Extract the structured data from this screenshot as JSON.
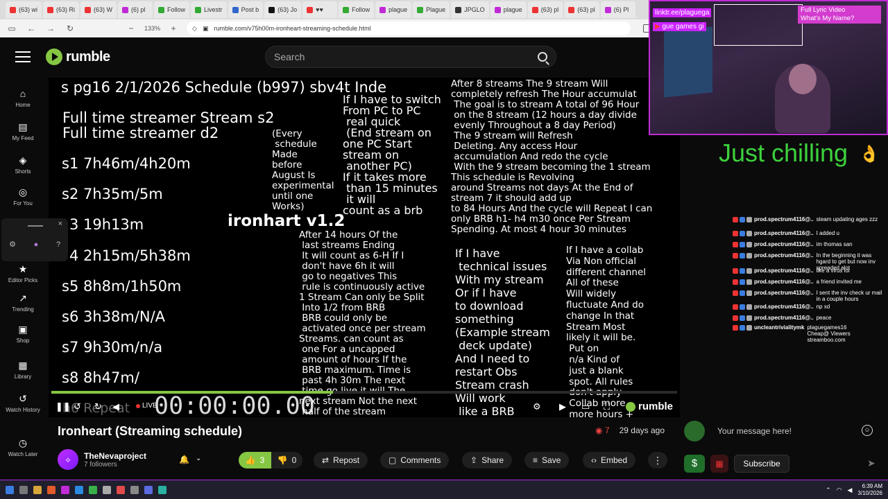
{
  "browser": {
    "tabs": [
      {
        "label": "(63) wi",
        "color": "#e33"
      },
      {
        "label": "(63) Ri",
        "color": "#e33"
      },
      {
        "label": "(63) W",
        "color": "#e33"
      },
      {
        "label": "(6) pl",
        "color": "#c02bd6"
      },
      {
        "label": "Follow",
        "color": "#3a3"
      },
      {
        "label": "Livestr",
        "color": "#3a3"
      },
      {
        "label": "Post b",
        "color": "#36c"
      },
      {
        "label": "(63) Jo",
        "color": "#111"
      },
      {
        "label": "♥♥",
        "color": "#e33"
      },
      {
        "label": "Follow",
        "color": "#3a3"
      },
      {
        "label": "plague",
        "color": "#c02bd6"
      },
      {
        "label": "Plague",
        "color": "#3a3"
      },
      {
        "label": "JPGLO",
        "color": "#333"
      },
      {
        "label": "plague",
        "color": "#c02bd6"
      },
      {
        "label": "(63) pl",
        "color": "#e33"
      },
      {
        "label": "(63) pl",
        "color": "#e33"
      },
      {
        "label": "(6) Pl",
        "color": "#c02bd6"
      }
    ],
    "zoom": "133%",
    "url": "rumble.com/v75h00m-ironheart-streaming-schedule.html"
  },
  "header": {
    "logo_text": "rumble",
    "search_placeholder": "Search"
  },
  "leftnav": [
    {
      "label": "Home",
      "icon": "home-icon",
      "glyph": "⌂"
    },
    {
      "label": "My Feed",
      "icon": "feed-icon",
      "glyph": "▤"
    },
    {
      "label": "Shorts",
      "icon": "shorts-icon",
      "glyph": "◈"
    },
    {
      "label": "For You",
      "icon": "for-you-icon",
      "glyph": "◎"
    },
    {
      "label": "Editor Picks",
      "icon": "editor-picks-icon",
      "glyph": "★"
    },
    {
      "label": "Trending",
      "icon": "trending-icon",
      "glyph": "↗"
    },
    {
      "label": "Shop",
      "icon": "shop-icon",
      "glyph": "▣"
    },
    {
      "label": "Library",
      "icon": "library-icon",
      "glyph": "▦"
    },
    {
      "label": "Watch History",
      "icon": "history-icon",
      "glyph": "↺"
    },
    {
      "label": "Watch Later",
      "icon": "clock-icon",
      "glyph": "◷"
    }
  ],
  "video": {
    "header_line": "s pg16 2/1/2026 Schedule (b997) sbv4t Inde",
    "full_time_1": "Full time streamer Stream s2",
    "full_time_2": "Full time streamer d2",
    "streams": [
      "s1 7h46m/4h20m",
      "s2 7h35m/5m",
      "3 19h13m",
      "4 2h15m/5h38m",
      "s5 8h8m/1h50m",
      "s6 3h38m/N/A",
      "s7 9h30m/n/a",
      "s8 8h47m/"
    ],
    "repeat_ghost": "h6 Repeat",
    "version": "ironhart v1.2",
    "every_schedule": "(Every\n schedule\nMade\nbefore\nAugust Is\nexperimental\nuntil one\nWorks)",
    "switch_pc": "If I have to switch\nFrom PC to PC\n real quick\n (End stream on\none PC Start\nstream on\n another PC)\nIf it takes more\n than 15 minutes\n it will\ncount as a brb",
    "after_14": "After 14 hours Of the\n last streams Ending\n It will count as 6-H If I\n don't have 6h it will\n go to negatives This\n rule is continuously active\n1 Stream Can only be Split\n Into 1/2 from BRB\n BRB could only be\n activated once per stream\nStreams. can count as\n one For a uncapped\n amount of hours If the\n BRB maximum. Time is\n past 4h 30m The next\n time go live it will The\nnext stream Not the next\n half of the stream",
    "after_8": "After 8 streams The 9 stream Will\ncompletely refresh The Hour accumulat\n The goal is to stream A total of 96 Hour\n on the 8 stream (12 hours a day divide\n evenly Throughout a 8 day Period)\n The 9 stream will Refresh\n Deleting. Any access Hour\n accumulation And redo the cycle\n With the 9 stream becoming the 1 stream\nThis schedule is Revolving\naround Streams not days At the End of\nstream 7 it should add up\nto 84 Hours And the cycle will Repeat I can\nonly BRB h1- h4 m30 once Per Stream\nSpending. At most 4 hour 30 minutes",
    "tech_issues": "If I have\n technical issues\nWith my stream\nOr if I have\nto download\nsomething\n(Example stream\n deck update)\nAnd I need to\nrestart Obs\nStream crash\nWill work\n like a BRB",
    "collab": "If I have a collab\nVia Non official\ndifferent channel\nAll of these\nWill widely\nfluctuate And do\nchange In that\nStream Most\nlikely it will be.\n Put on\n n/a Kind of\n just a blank\n spot. All rules\n don't apply\n Collab more\n more hours +",
    "live_label": "LIVE",
    "timecode": "00:00:00.00",
    "progress": 0.45,
    "watermark": "rumble"
  },
  "title_row": {
    "title": "Ironheart (Streaming schedule)",
    "rants": "7",
    "age": "29 days ago",
    "channel_name": "TheNevaproject",
    "followers": "7 followers",
    "upvotes": "3",
    "downvotes": "0",
    "repost": "Repost",
    "comments": "Comments",
    "share": "Share",
    "save": "Save",
    "embed": "Embed"
  },
  "overlay": {
    "linktree": "linktr.ee/plaguega",
    "plague_tag": "gue games gi",
    "lyric_title": "Full Lyric Video",
    "lyric_song": "What's My Name?",
    "status_text": "Just chilling",
    "status_emoji": "👌"
  },
  "chat": [
    {
      "user": "prod.spectrum4116@..",
      "msg": "steam updating ages zzz"
    },
    {
      "user": "prod.spectrum4116@..",
      "msg": "I added u"
    },
    {
      "user": "prod.spectrum4116@..",
      "msg": "im thomas san"
    },
    {
      "user": "prod.spectrum4116@..",
      "msg": "In the beginning it was hgard to get but now inv spreaded alot"
    },
    {
      "user": "prod.spectrum4116@..",
      "msg": "like a virus lol"
    },
    {
      "user": "prod.spectrum4116@..",
      "msg": "a friend invited me"
    },
    {
      "user": "prod.spectrum4116@..",
      "msg": "I sent the inv check ur mail in a couple hours"
    },
    {
      "user": "prod.spectrum4116@..",
      "msg": "np xd"
    },
    {
      "user": "prod.spectrum4116@..",
      "msg": "peace"
    },
    {
      "user": "uncleantrivialitymk",
      "msg": "plaguegames16 Cheap@ Viewers streamboo.com"
    }
  ],
  "chat_input": {
    "placeholder": "Your message here!",
    "subscribe": "Subscribe"
  },
  "taskbar": {
    "time": "6:39 AM",
    "date": "3/10/2026"
  }
}
